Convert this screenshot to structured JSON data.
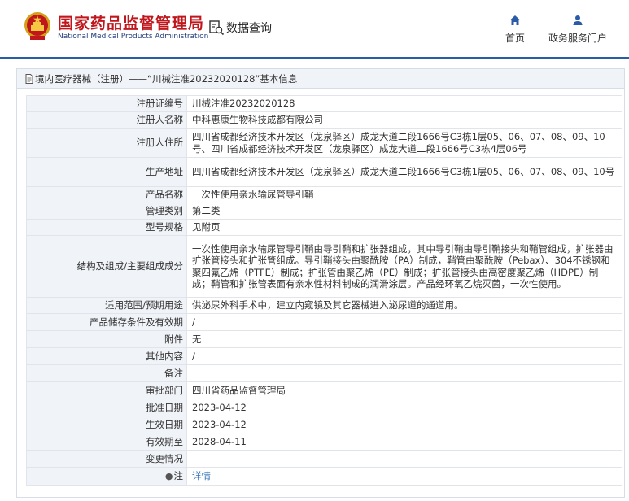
{
  "header": {
    "site_name_cn": "国家药品监督管理局",
    "site_name_en": "National Medical Products Administration",
    "query_label": "数据查询",
    "nav": [
      {
        "label": "首页",
        "icon": "home-icon"
      },
      {
        "label": "政务服务门户",
        "icon": "user-icon"
      }
    ]
  },
  "breadcrumb": "境内医疗器械（注册）——“川械注准20232020128”基本信息",
  "colors": {
    "brand_red": "#c0171d",
    "brand_blue": "#2a5ba7",
    "link": "#2f6fb5",
    "label_bg": "#f0f3f7"
  },
  "rows": [
    {
      "label": "注册证编号",
      "value": "川械注准20232020128"
    },
    {
      "label": "注册人名称",
      "value": "中科惠康生物科技成都有限公司"
    },
    {
      "label": "注册人住所",
      "value": "四川省成都经济技术开发区（龙泉驿区）成龙大道二段1666号C3栋1层05、06、07、08、09、10号、四川省成都经济技术开发区（龙泉驿区）成龙大道二段1666号C3栋4层06号"
    },
    {
      "label": "生产地址",
      "value": "四川省成都经济技术开发区（龙泉驿区）成龙大道二段1666号C3栋1层05、06、07、08、09、10号"
    },
    {
      "label": "产品名称",
      "value": "一次性使用亲水输尿管导引鞘"
    },
    {
      "label": "管理类别",
      "value": "第二类"
    },
    {
      "label": "型号规格",
      "value": "见附页"
    },
    {
      "label": "结构及组成/主要组成成分",
      "value": "一次性使用亲水输尿管导引鞘由导引鞘和扩张器组成，其中导引鞘由导引鞘接头和鞘管组成，扩张器由扩张管接头和扩张管组成。导引鞘接头由聚酰胺（PA）制成，鞘管由聚酰胺（Pebax）、304不锈钢和聚四氟乙烯（PTFE）制成；扩张管由聚乙烯（PE）制成；扩张管接头由高密度聚乙烯（HDPE）制成；鞘管和扩张管表面有亲水性材料制成的润滑涂层。产品经环氧乙烷灭菌，一次性使用。"
    },
    {
      "label": "适用范围/预期用途",
      "value": "供泌尿外科手术中，建立内窥镜及其它器械进入泌尿道的通道用。"
    },
    {
      "label": "产品储存条件及有效期",
      "value": "/"
    },
    {
      "label": "附件",
      "value": "无"
    },
    {
      "label": "其他内容",
      "value": "/"
    },
    {
      "label": "备注",
      "value": ""
    },
    {
      "label": "审批部门",
      "value": "四川省药品监督管理局"
    },
    {
      "label": "批准日期",
      "value": "2023-04-12"
    },
    {
      "label": "生效日期",
      "value": "2023-04-12"
    },
    {
      "label": "有效期至",
      "value": "2028-04-11"
    },
    {
      "label": "变更情况",
      "value": ""
    },
    {
      "label": "注",
      "value": "详情"
    }
  ]
}
